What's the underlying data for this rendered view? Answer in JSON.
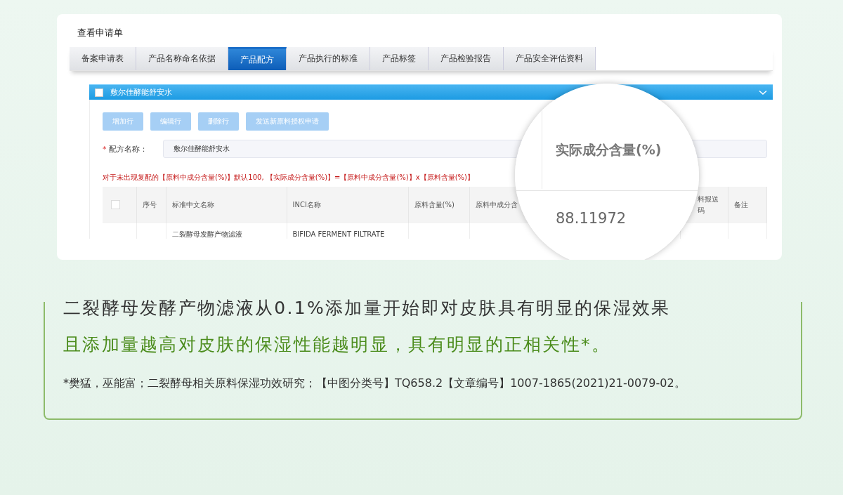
{
  "window": {
    "title": "查看申请单"
  },
  "tabs": [
    {
      "label": "备案申请表",
      "selected": false
    },
    {
      "label": "产品名称命名依据",
      "selected": false
    },
    {
      "label": "产品配方",
      "selected": true
    },
    {
      "label": "产品执行的标准",
      "selected": false
    },
    {
      "label": "产品标签",
      "selected": false
    },
    {
      "label": "产品检验报告",
      "selected": false
    },
    {
      "label": "产品安全评估资料",
      "selected": false
    }
  ],
  "panel": {
    "title": "敷尔佳酵能舒安水",
    "checked": false,
    "expanded": true
  },
  "toolbar": [
    {
      "label": "增加行",
      "disabled": true
    },
    {
      "label": "编辑行",
      "disabled": true
    },
    {
      "label": "删除行",
      "disabled": true
    },
    {
      "label": "发送新原料授权申请",
      "disabled": true
    }
  ],
  "form": {
    "label": "配方名称：",
    "required": true,
    "required_mark": "*",
    "value": "敷尔佳酵能舒安水"
  },
  "note": "对于未出现复配的【原料中成分含量(%)】默认100, 【实际成分含量(%)】=【原料中成分含量(%)】x【原料含量(%)】",
  "table": {
    "all_checked": false,
    "columns": [
      "序号",
      "标准中文名称",
      "INCI名称",
      "原料含量(%)",
      "原料中成分含",
      "料报送码",
      "备注"
    ],
    "rows": [
      {
        "name": "二裂酵母发酵产物滤液",
        "inci": "BIFIDA FERMENT FILTRATE"
      }
    ]
  },
  "magnifier": {
    "heading": "实际成分含量(%)",
    "value": "88.11972"
  },
  "caption": {
    "lines": [
      {
        "kind": "plain",
        "text": "二裂酵母发酵产物滤液从0.1%添加量开始即对皮肤具有明显的保湿效果"
      },
      {
        "kind": "accent",
        "text": "且添加量越高对皮肤的保湿性能越明显，具有明显的正相关性*。"
      }
    ],
    "citation": "*樊猛，巫能富；二裂酵母相关原料保湿功效研究；【中图分类号】TQ658.2【文章编号】1007-1865(2021)21-0079-02。"
  }
}
